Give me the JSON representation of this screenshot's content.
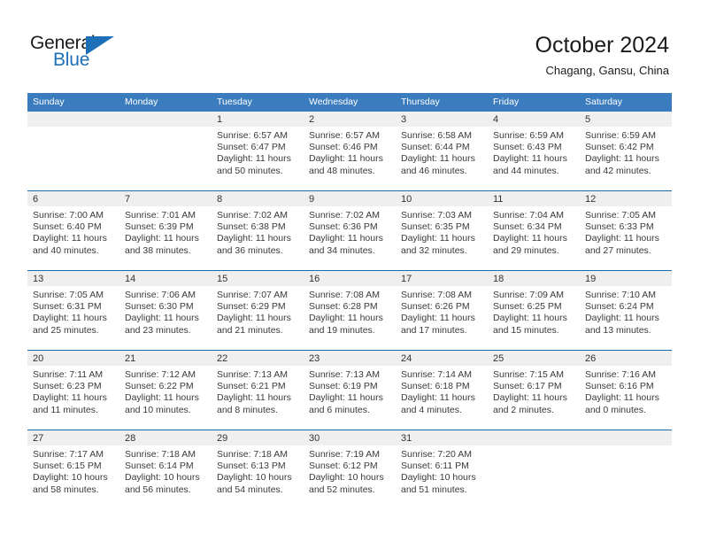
{
  "brand": {
    "name_part1": "General",
    "name_part2": "Blue",
    "triangle_color": "#1d70b7"
  },
  "header": {
    "title": "October 2024",
    "location": "Chagang, Gansu, China"
  },
  "colors": {
    "header_blue": "#3b7cbf",
    "separator_blue": "#1d6cb0",
    "day_band_gray": "#efefef",
    "text": "#3a3a3a"
  },
  "weekday_headers": [
    "Sunday",
    "Monday",
    "Tuesday",
    "Wednesday",
    "Thursday",
    "Friday",
    "Saturday"
  ],
  "weeks": [
    [
      {
        "blank": true
      },
      {
        "blank": true
      },
      {
        "day": "1",
        "sunrise": "Sunrise: 6:57 AM",
        "sunset": "Sunset: 6:47 PM",
        "daylight_line1": "Daylight: 11 hours",
        "daylight_line2": "and 50 minutes."
      },
      {
        "day": "2",
        "sunrise": "Sunrise: 6:57 AM",
        "sunset": "Sunset: 6:46 PM",
        "daylight_line1": "Daylight: 11 hours",
        "daylight_line2": "and 48 minutes."
      },
      {
        "day": "3",
        "sunrise": "Sunrise: 6:58 AM",
        "sunset": "Sunset: 6:44 PM",
        "daylight_line1": "Daylight: 11 hours",
        "daylight_line2": "and 46 minutes."
      },
      {
        "day": "4",
        "sunrise": "Sunrise: 6:59 AM",
        "sunset": "Sunset: 6:43 PM",
        "daylight_line1": "Daylight: 11 hours",
        "daylight_line2": "and 44 minutes."
      },
      {
        "day": "5",
        "sunrise": "Sunrise: 6:59 AM",
        "sunset": "Sunset: 6:42 PM",
        "daylight_line1": "Daylight: 11 hours",
        "daylight_line2": "and 42 minutes."
      }
    ],
    [
      {
        "day": "6",
        "sunrise": "Sunrise: 7:00 AM",
        "sunset": "Sunset: 6:40 PM",
        "daylight_line1": "Daylight: 11 hours",
        "daylight_line2": "and 40 minutes."
      },
      {
        "day": "7",
        "sunrise": "Sunrise: 7:01 AM",
        "sunset": "Sunset: 6:39 PM",
        "daylight_line1": "Daylight: 11 hours",
        "daylight_line2": "and 38 minutes."
      },
      {
        "day": "8",
        "sunrise": "Sunrise: 7:02 AM",
        "sunset": "Sunset: 6:38 PM",
        "daylight_line1": "Daylight: 11 hours",
        "daylight_line2": "and 36 minutes."
      },
      {
        "day": "9",
        "sunrise": "Sunrise: 7:02 AM",
        "sunset": "Sunset: 6:36 PM",
        "daylight_line1": "Daylight: 11 hours",
        "daylight_line2": "and 34 minutes."
      },
      {
        "day": "10",
        "sunrise": "Sunrise: 7:03 AM",
        "sunset": "Sunset: 6:35 PM",
        "daylight_line1": "Daylight: 11 hours",
        "daylight_line2": "and 32 minutes."
      },
      {
        "day": "11",
        "sunrise": "Sunrise: 7:04 AM",
        "sunset": "Sunset: 6:34 PM",
        "daylight_line1": "Daylight: 11 hours",
        "daylight_line2": "and 29 minutes."
      },
      {
        "day": "12",
        "sunrise": "Sunrise: 7:05 AM",
        "sunset": "Sunset: 6:33 PM",
        "daylight_line1": "Daylight: 11 hours",
        "daylight_line2": "and 27 minutes."
      }
    ],
    [
      {
        "day": "13",
        "sunrise": "Sunrise: 7:05 AM",
        "sunset": "Sunset: 6:31 PM",
        "daylight_line1": "Daylight: 11 hours",
        "daylight_line2": "and 25 minutes."
      },
      {
        "day": "14",
        "sunrise": "Sunrise: 7:06 AM",
        "sunset": "Sunset: 6:30 PM",
        "daylight_line1": "Daylight: 11 hours",
        "daylight_line2": "and 23 minutes."
      },
      {
        "day": "15",
        "sunrise": "Sunrise: 7:07 AM",
        "sunset": "Sunset: 6:29 PM",
        "daylight_line1": "Daylight: 11 hours",
        "daylight_line2": "and 21 minutes."
      },
      {
        "day": "16",
        "sunrise": "Sunrise: 7:08 AM",
        "sunset": "Sunset: 6:28 PM",
        "daylight_line1": "Daylight: 11 hours",
        "daylight_line2": "and 19 minutes."
      },
      {
        "day": "17",
        "sunrise": "Sunrise: 7:08 AM",
        "sunset": "Sunset: 6:26 PM",
        "daylight_line1": "Daylight: 11 hours",
        "daylight_line2": "and 17 minutes."
      },
      {
        "day": "18",
        "sunrise": "Sunrise: 7:09 AM",
        "sunset": "Sunset: 6:25 PM",
        "daylight_line1": "Daylight: 11 hours",
        "daylight_line2": "and 15 minutes."
      },
      {
        "day": "19",
        "sunrise": "Sunrise: 7:10 AM",
        "sunset": "Sunset: 6:24 PM",
        "daylight_line1": "Daylight: 11 hours",
        "daylight_line2": "and 13 minutes."
      }
    ],
    [
      {
        "day": "20",
        "sunrise": "Sunrise: 7:11 AM",
        "sunset": "Sunset: 6:23 PM",
        "daylight_line1": "Daylight: 11 hours",
        "daylight_line2": "and 11 minutes."
      },
      {
        "day": "21",
        "sunrise": "Sunrise: 7:12 AM",
        "sunset": "Sunset: 6:22 PM",
        "daylight_line1": "Daylight: 11 hours",
        "daylight_line2": "and 10 minutes."
      },
      {
        "day": "22",
        "sunrise": "Sunrise: 7:13 AM",
        "sunset": "Sunset: 6:21 PM",
        "daylight_line1": "Daylight: 11 hours",
        "daylight_line2": "and 8 minutes."
      },
      {
        "day": "23",
        "sunrise": "Sunrise: 7:13 AM",
        "sunset": "Sunset: 6:19 PM",
        "daylight_line1": "Daylight: 11 hours",
        "daylight_line2": "and 6 minutes."
      },
      {
        "day": "24",
        "sunrise": "Sunrise: 7:14 AM",
        "sunset": "Sunset: 6:18 PM",
        "daylight_line1": "Daylight: 11 hours",
        "daylight_line2": "and 4 minutes."
      },
      {
        "day": "25",
        "sunrise": "Sunrise: 7:15 AM",
        "sunset": "Sunset: 6:17 PM",
        "daylight_line1": "Daylight: 11 hours",
        "daylight_line2": "and 2 minutes."
      },
      {
        "day": "26",
        "sunrise": "Sunrise: 7:16 AM",
        "sunset": "Sunset: 6:16 PM",
        "daylight_line1": "Daylight: 11 hours",
        "daylight_line2": "and 0 minutes."
      }
    ],
    [
      {
        "day": "27",
        "sunrise": "Sunrise: 7:17 AM",
        "sunset": "Sunset: 6:15 PM",
        "daylight_line1": "Daylight: 10 hours",
        "daylight_line2": "and 58 minutes."
      },
      {
        "day": "28",
        "sunrise": "Sunrise: 7:18 AM",
        "sunset": "Sunset: 6:14 PM",
        "daylight_line1": "Daylight: 10 hours",
        "daylight_line2": "and 56 minutes."
      },
      {
        "day": "29",
        "sunrise": "Sunrise: 7:18 AM",
        "sunset": "Sunset: 6:13 PM",
        "daylight_line1": "Daylight: 10 hours",
        "daylight_line2": "and 54 minutes."
      },
      {
        "day": "30",
        "sunrise": "Sunrise: 7:19 AM",
        "sunset": "Sunset: 6:12 PM",
        "daylight_line1": "Daylight: 10 hours",
        "daylight_line2": "and 52 minutes."
      },
      {
        "day": "31",
        "sunrise": "Sunrise: 7:20 AM",
        "sunset": "Sunset: 6:11 PM",
        "daylight_line1": "Daylight: 10 hours",
        "daylight_line2": "and 51 minutes."
      },
      {
        "blank": true
      },
      {
        "blank": true
      }
    ]
  ]
}
